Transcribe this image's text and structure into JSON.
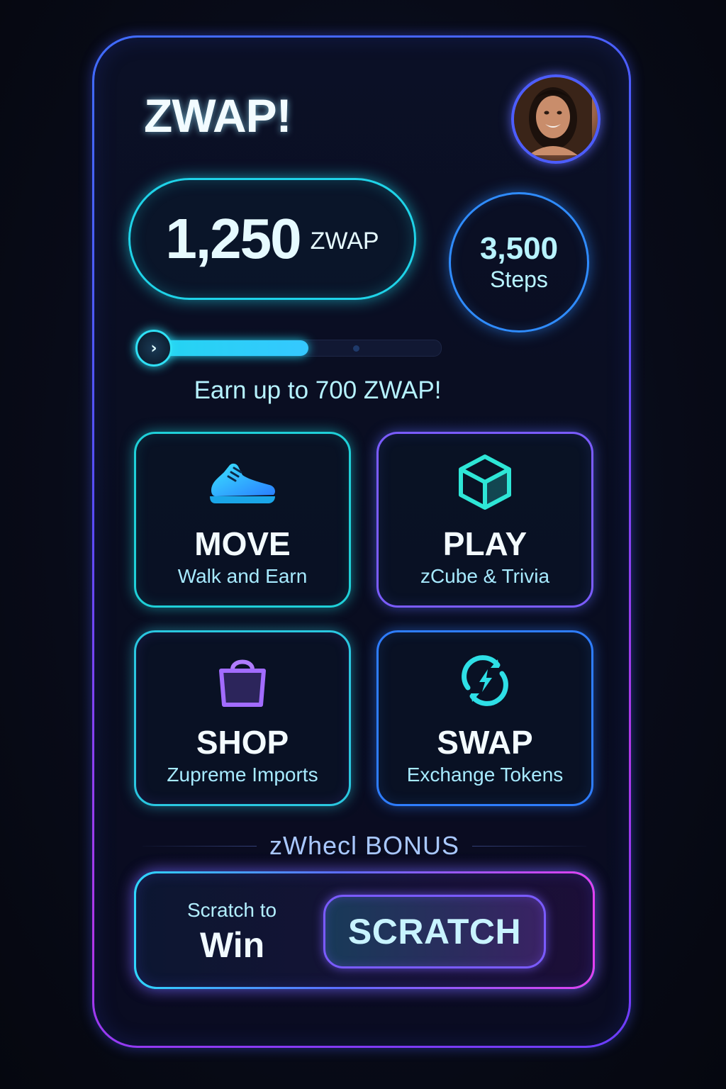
{
  "app": {
    "logo": "ZWAP!"
  },
  "balance": {
    "amount": "1,250",
    "unit": "ZWAP"
  },
  "steps": {
    "value": "3,500",
    "label": "Steps"
  },
  "progress": {
    "fraction": 0.56
  },
  "earn": {
    "text": "Earn up to 700 ZWAP!"
  },
  "tiles": [
    {
      "title": "MOVE",
      "subtitle": "Walk and Earn",
      "icon": "sneaker-icon"
    },
    {
      "title": "PLAY",
      "subtitle": "zCube & Trivia",
      "icon": "cube-icon"
    },
    {
      "title": "SHOP",
      "subtitle": "Zupreme Imports",
      "icon": "shopping-bag-icon"
    },
    {
      "title": "SWAP",
      "subtitle": "Exchange Tokens",
      "icon": "swap-bolt-icon"
    }
  ],
  "bonus": {
    "title": "zWhecl BONUS"
  },
  "scratch": {
    "label_small": "Scratch to",
    "label_big": "Win",
    "button": "SCRATCH"
  },
  "colors": {
    "cyan": "#22d6f0",
    "blue": "#3f6dff",
    "violet": "#7b5cff",
    "magenta": "#e33ff0"
  }
}
